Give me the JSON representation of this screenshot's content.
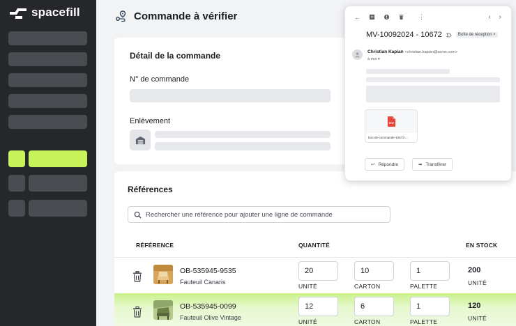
{
  "brand": {
    "name": "spacefill",
    "accent": "#c6f35a"
  },
  "page": {
    "title": "Commande à vérifier"
  },
  "order_detail": {
    "title": "Détail de la commande",
    "order_number_label": "N° de commande",
    "pickup_label": "Enlèvement"
  },
  "references": {
    "title": "Références",
    "search_placeholder": "Rechercher une référence pour ajouter une ligne de commande",
    "headers": {
      "reference": "RÉFÉRENCE",
      "quantity": "QUANTITÉ",
      "stock": "EN STOCK"
    },
    "rows": [
      {
        "sku": "OB-535945-9535",
        "name": "Fauteuil Canaris",
        "qty_unit": "20",
        "qty_unit_label": "UNITÉ",
        "qty_carton": "10",
        "qty_carton_label": "CARTON",
        "qty_palette": "1",
        "qty_palette_label": "PALETTE",
        "stock": "200",
        "stock_unit": "UNITÉ"
      },
      {
        "sku": "OB-535945-0099",
        "name": "Fauteuil Olive Vintage",
        "qty_unit": "12",
        "qty_unit_label": "UNITÉ",
        "qty_carton": "6",
        "qty_carton_label": "CARTON",
        "qty_palette": "1",
        "qty_palette_label": "PALETTE",
        "stock": "120",
        "stock_unit": "UNITÉ"
      }
    ]
  },
  "email": {
    "subject": "MV-10092024 - 10672",
    "badge": "Boîte de réception ×",
    "sender_name": "Christian Kapian",
    "sender_email": "<christian.kapian@acme.com>",
    "recipient": "à moi ▾",
    "attachment_name": "bon-de-commande-10672-...",
    "attachment_type": "PDF",
    "reply_label": "Répondre",
    "forward_label": "Transférer"
  }
}
